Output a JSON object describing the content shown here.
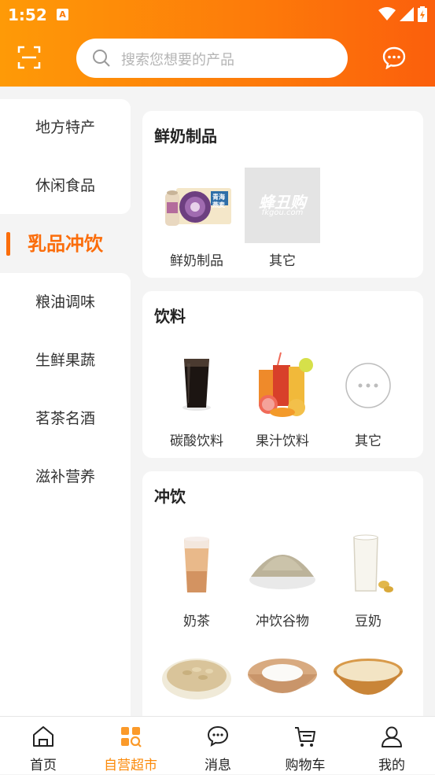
{
  "status_bar": {
    "time": "1:52",
    "notification_letter": "A"
  },
  "colors": {
    "accent": "#fb6d0b",
    "header_start": "#fe9a07",
    "header_end": "#fb5f0c",
    "tab_active": "#fb8a0a"
  },
  "search": {
    "placeholder": "搜索您想要的产品"
  },
  "sidebar": {
    "items": [
      {
        "label": "地方特产"
      },
      {
        "label": "休闲食品"
      },
      {
        "label": "乳品冲饮",
        "active": true
      },
      {
        "label": "粮油调味"
      },
      {
        "label": "生鲜果蔬"
      },
      {
        "label": "茗茶名酒"
      },
      {
        "label": "滋补营养"
      }
    ]
  },
  "sections": [
    {
      "title": "鲜奶制品",
      "items": [
        {
          "label": "鲜奶制品",
          "icon": "milk-box-image",
          "image_text": [
            "青海",
            "燕麦"
          ]
        },
        {
          "label": "其它",
          "icon": "placeholder-image",
          "image_text": [
            "蜂丑购",
            "fkgou.com"
          ]
        }
      ]
    },
    {
      "title": "饮料",
      "items": [
        {
          "label": "碳酸饮料",
          "icon": "cola-glass-image"
        },
        {
          "label": "果汁饮料",
          "icon": "juice-image"
        },
        {
          "label": "其它",
          "icon": "more-dots-icon"
        }
      ]
    },
    {
      "title": "冲饮",
      "items": [
        {
          "label": "奶茶",
          "icon": "milk-tea-image"
        },
        {
          "label": "冲饮谷物",
          "icon": "grain-powder-image"
        },
        {
          "label": "豆奶",
          "icon": "soy-milk-image"
        },
        {
          "icon": "oats-bowl-image"
        },
        {
          "icon": "flour-bowl-image"
        },
        {
          "icon": "rice-paste-bowl-image"
        }
      ]
    }
  ],
  "tabbar": {
    "tabs": [
      {
        "label": "首页",
        "icon": "home-icon"
      },
      {
        "label": "自营超市",
        "icon": "supermarket-icon",
        "active": true
      },
      {
        "label": "消息",
        "icon": "message-icon"
      },
      {
        "label": "购物车",
        "icon": "cart-icon"
      },
      {
        "label": "我的",
        "icon": "user-icon"
      }
    ]
  }
}
